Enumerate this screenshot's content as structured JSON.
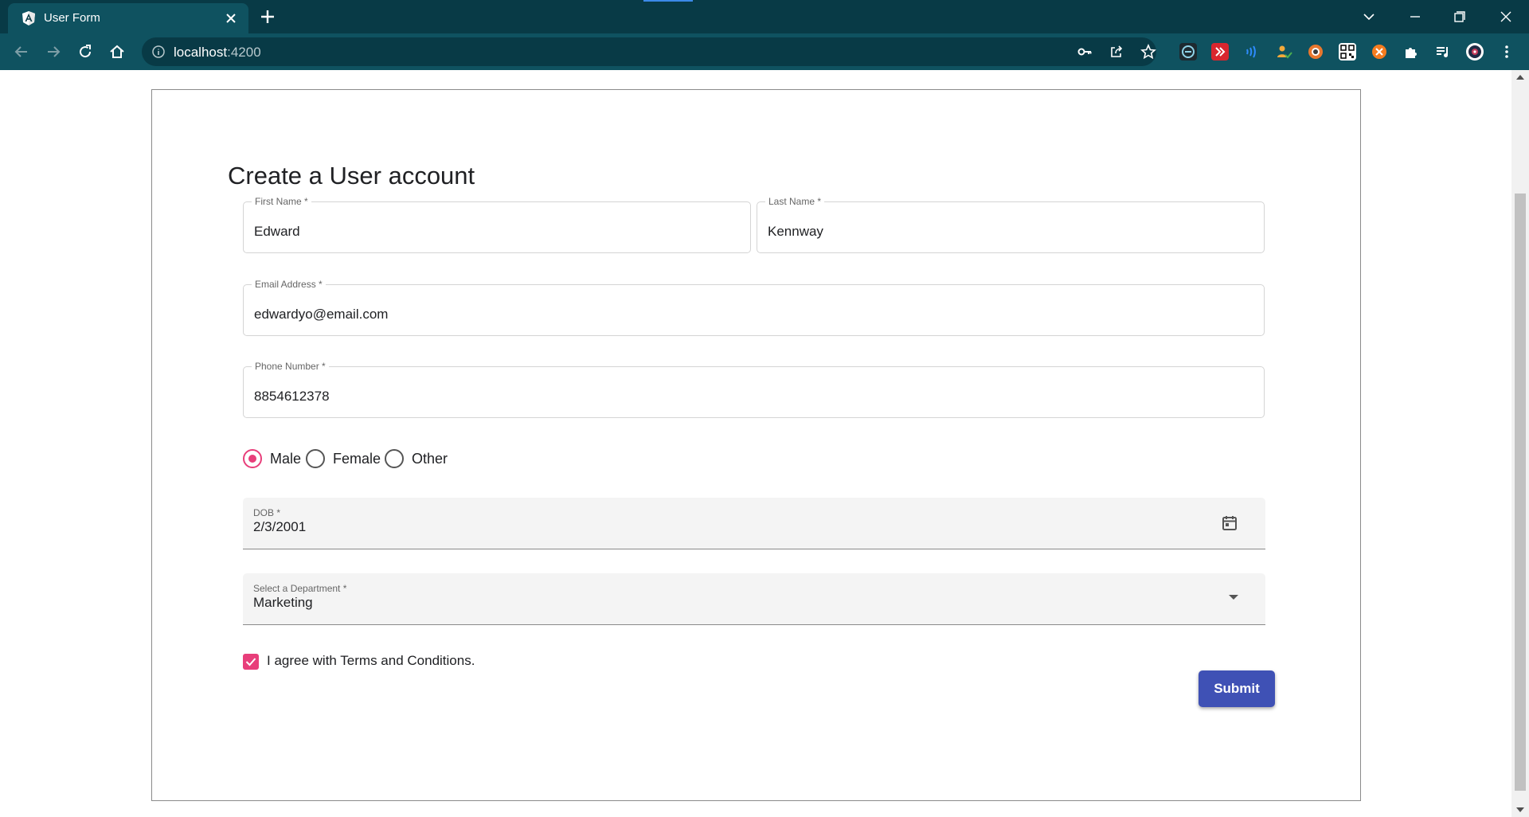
{
  "browser": {
    "tab": {
      "title": "User Form",
      "favicon": "angular-logo-icon"
    },
    "address": {
      "host": "localhost",
      "port": ":4200"
    }
  },
  "form": {
    "title": "Create a User account",
    "first_name": {
      "label": "First Name *",
      "value": "Edward"
    },
    "last_name": {
      "label": "Last Name *",
      "value": "Kennway"
    },
    "email": {
      "label": "Email Address *",
      "value": "edwardyo@email.com"
    },
    "phone": {
      "label": "Phone Number *",
      "value": "8854612378"
    },
    "gender": {
      "options": [
        {
          "label": "Male",
          "selected": true
        },
        {
          "label": "Female",
          "selected": false
        },
        {
          "label": "Other",
          "selected": false
        }
      ]
    },
    "dob": {
      "label": "DOB *",
      "value": "2/3/2001"
    },
    "department": {
      "label": "Select a Department *",
      "value": "Marketing"
    },
    "terms": {
      "label": "I agree with Terms and Conditions.",
      "checked": true
    },
    "submit_label": "Submit"
  },
  "colors": {
    "accent_pink": "#e83e7a",
    "primary_indigo": "#3f51b5",
    "chrome_dark": "#083a46",
    "chrome_toolbar": "#0f5260"
  }
}
